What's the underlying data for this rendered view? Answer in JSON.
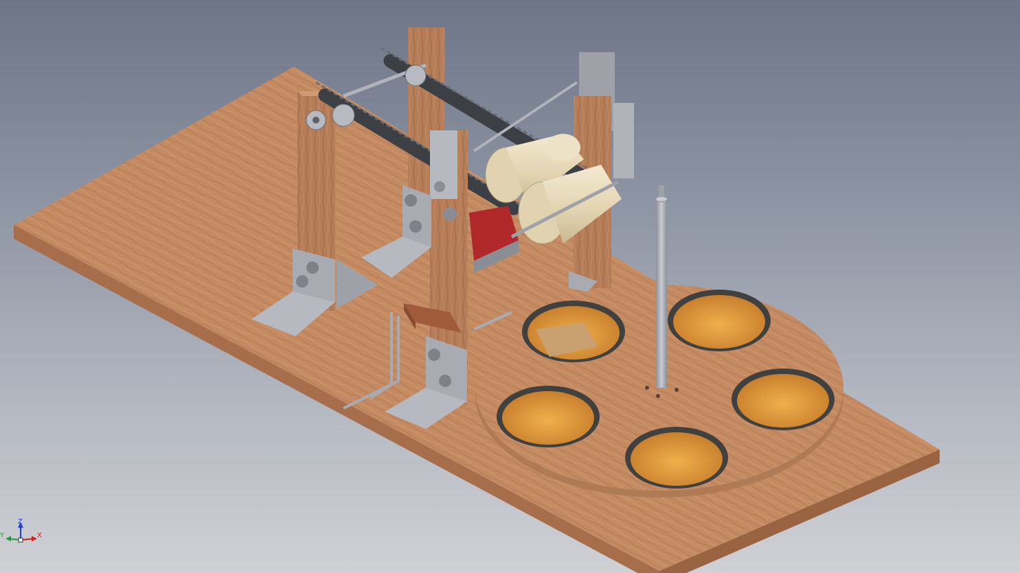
{
  "viewport": {
    "background_top": "#6d7587",
    "background_bottom": "#cfd1d5"
  },
  "model": {
    "wood_color": "#c48a62",
    "wood_edge": "#a76e4c",
    "metal_color": "#a8acb2",
    "red_part_color": "#b0282a",
    "roller_color": "#e8dcc0",
    "cup_wells": 5
  },
  "triad": {
    "x_label": "X",
    "y_label": "Y",
    "z_label": "Z",
    "x_color": "#d21f1f",
    "y_color": "#1fa13a",
    "z_color": "#1f3fd2"
  }
}
